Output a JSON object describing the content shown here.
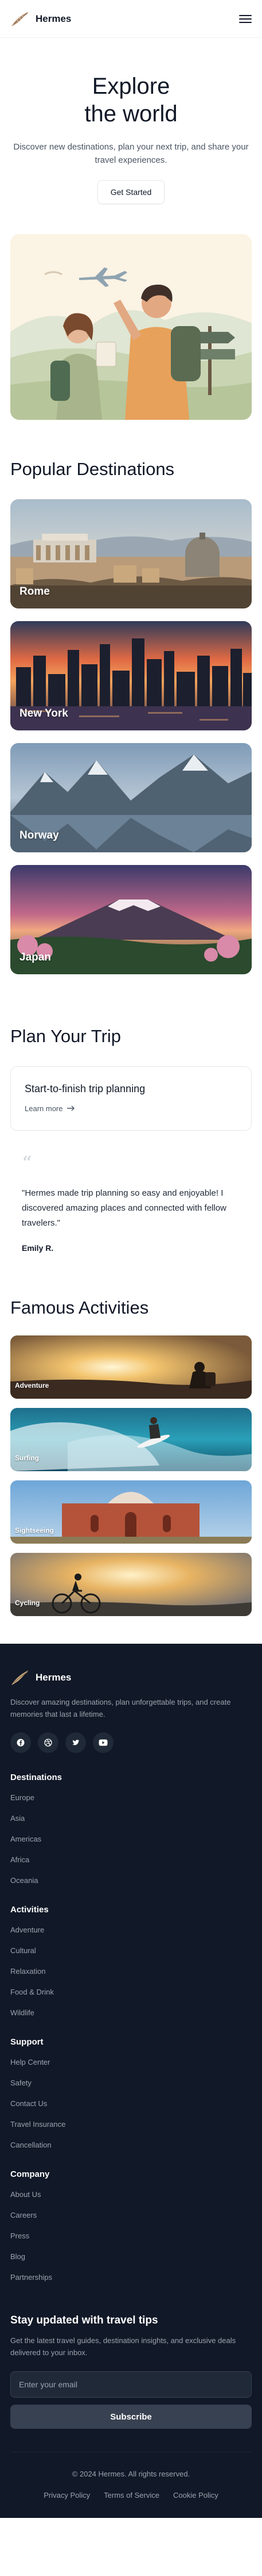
{
  "header": {
    "brand": "Hermes",
    "logo_icon": "feather-icon",
    "menu_icon": "hamburger-menu-icon"
  },
  "hero": {
    "title_line1": "Explore",
    "title_line2": "the world",
    "subtitle": "Discover new destinations, plan your next trip, and share your travel experiences.",
    "cta": "Get Started",
    "illustration": "travelers-illustration"
  },
  "destinations": {
    "title": "Popular Destinations",
    "items": [
      {
        "label": "Rome"
      },
      {
        "label": "New York"
      },
      {
        "label": "Norway"
      },
      {
        "label": "Japan"
      }
    ]
  },
  "plan": {
    "title": "Plan Your Trip",
    "card_title": "Start-to-finish trip planning",
    "learn_more": "Learn more",
    "arrow_icon": "arrow-right-icon"
  },
  "testimonial": {
    "quote_icon": "quote-icon",
    "text": "\"Hermes made trip planning so easy and enjoyable! I discovered amazing places and connected with fellow travelers.\"",
    "author": "Emily R."
  },
  "activities": {
    "title": "Famous Activities",
    "items": [
      {
        "label": "Adventure"
      },
      {
        "label": "Surfing"
      },
      {
        "label": "Sightseeing"
      },
      {
        "label": "Cycling"
      }
    ]
  },
  "footer": {
    "brand": "Hermes",
    "description": "Discover amazing destinations, plan unforgettable trips, and create memories that last a lifetime.",
    "socials": [
      "facebook-icon",
      "dribbble-icon",
      "twitter-icon",
      "youtube-icon"
    ],
    "groups": [
      {
        "title": "Destinations",
        "links": [
          "Europe",
          "Asia",
          "Americas",
          "Africa",
          "Oceania"
        ]
      },
      {
        "title": "Activities",
        "links": [
          "Adventure",
          "Cultural",
          "Relaxation",
          "Food & Drink",
          "Wildlife"
        ]
      },
      {
        "title": "Support",
        "links": [
          "Help Center",
          "Safety",
          "Contact Us",
          "Travel Insurance",
          "Cancellation"
        ]
      },
      {
        "title": "Company",
        "links": [
          "About Us",
          "Careers",
          "Press",
          "Blog",
          "Partnerships"
        ]
      }
    ],
    "newsletter": {
      "title": "Stay updated with travel tips",
      "text": "Get the latest travel guides, destination insights, and exclusive deals delivered to your inbox.",
      "placeholder": "Enter your email",
      "button": "Subscribe"
    },
    "copyright": "© 2024 Hermes. All rights reserved.",
    "legal": [
      "Privacy Policy",
      "Terms of Service",
      "Cookie Policy"
    ]
  },
  "colors": {
    "footer_bg": "#111827",
    "accent": "#c8a880"
  }
}
